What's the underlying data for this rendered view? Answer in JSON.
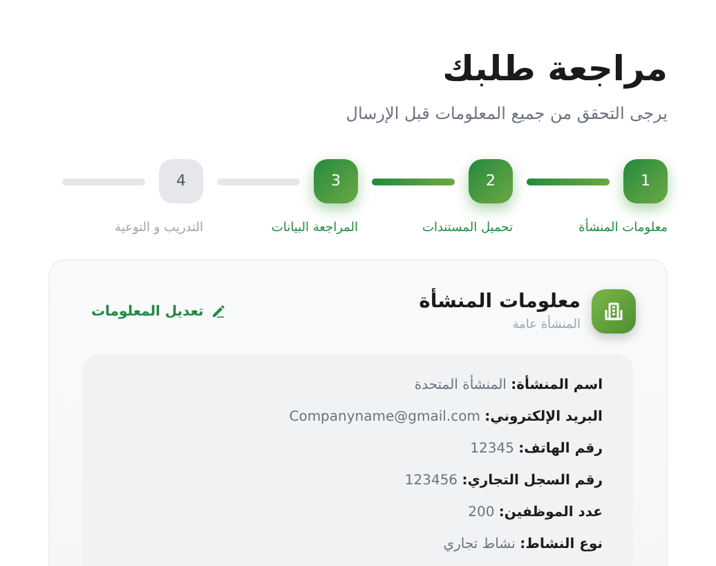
{
  "title": "مراجعة طلبك",
  "subtitle": "يرجى التحقق من جميع المعلومات قبل الإرسال",
  "steps": [
    {
      "number": "1",
      "label": "معلومات المنشأة",
      "completed": true
    },
    {
      "number": "2",
      "label": "تحميل المستندات",
      "completed": true
    },
    {
      "number": "3",
      "label": "المراجعة البيانات",
      "completed": true
    },
    {
      "number": "4",
      "label": "التدريب و التوعية",
      "completed": false
    }
  ],
  "card": {
    "title": "معلومات المنشأة",
    "subtitle": "المنشأة عامة",
    "edit_link": "تعديل المعلومات",
    "fields": [
      {
        "label": "اسم المنشأة:",
        "value": "المنشأة المتحدة"
      },
      {
        "label": "البريد الإلكتروني:",
        "value": "Companyname@gmail.com"
      },
      {
        "label": "رقم الهاتف:",
        "value": "12345"
      },
      {
        "label": "رقم السجل التجاري:",
        "value": "123456"
      },
      {
        "label": "عدد الموظفين:",
        "value": "200"
      },
      {
        "label": "نوع النشاط:",
        "value": "نشاط تجاري"
      }
    ]
  }
}
